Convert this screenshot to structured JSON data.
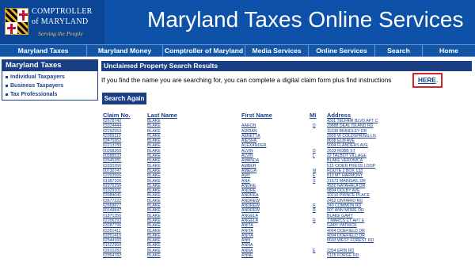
{
  "header": {
    "logo": {
      "line1": "COMPTROLLER",
      "line2": "of MARYLAND",
      "tagline": "Serving the People"
    },
    "title": "Maryland Taxes Online Services"
  },
  "nav": {
    "items": [
      {
        "label": "Maryland Taxes"
      },
      {
        "label": "Maryland Money"
      },
      {
        "label": "Comptroller of Maryland"
      },
      {
        "label": "Media Services"
      },
      {
        "label": "Online Services"
      },
      {
        "label": "Search"
      },
      {
        "label": "Home"
      }
    ]
  },
  "sidebar": {
    "heading": "Maryland Taxes",
    "items": [
      {
        "label": "Individual Taxpayers"
      },
      {
        "label": "Business Taxpayers"
      },
      {
        "label": "Tax Professionals"
      }
    ]
  },
  "main": {
    "section_title": "Unclaimed Property Search Results",
    "instructions": "If you find the name you are searching for, you can complete a digital claim form plus find instructions",
    "here_link": "HERE",
    "here_period": ".",
    "search_again": "Search Again"
  },
  "table": {
    "headers": {
      "claim": "Claim No.",
      "last": "Last Name",
      "first": "First Name",
      "mi": "MI",
      "address": "Address"
    },
    "rows": [
      {
        "claim": "02678742",
        "last": "BLAKE",
        "first": "",
        "mi": "",
        "address": "4311 TELFAIR BLVD APT C"
      },
      {
        "claim": "03324444",
        "last": "BLAKE",
        "first": "AARON",
        "mi": "D",
        "address": "29888 DEAL ISLAND RD"
      },
      {
        "claim": "02292553",
        "last": "BLAKE",
        "first": "ADRIAN",
        "mi": "",
        "address": "11038 BRINDLEY DR"
      },
      {
        "claim": "02099110",
        "last": "BLAKE",
        "first": "AENETTA",
        "mi": "",
        "address": "3909 W COLDSPRING LN"
      },
      {
        "claim": "03470362",
        "last": "BLAKE",
        "first": "AIESHA",
        "mi": "",
        "address": "8608 ELM AVE"
      },
      {
        "claim": "02213789",
        "last": "BLAKE",
        "first": "ALEXANDER",
        "mi": "",
        "address": "5004 FLANDERS AVE"
      },
      {
        "claim": "00268269",
        "last": "BLAKE",
        "first": "ALVIN",
        "mi": "D",
        "address": "2633 ROBB ST"
      },
      {
        "claim": "00388533",
        "last": "BLAKE",
        "first": "ALVIN",
        "mi": "L",
        "address": "22 TALBOT VILLAGE"
      },
      {
        "claim": "02645281",
        "last": "BLAKE",
        "first": "AMANDA",
        "mi": "",
        "address": "BLAKE VERONICA"
      },
      {
        "claim": "03320356",
        "last": "BLAKE",
        "first": "AMBER",
        "mi": "",
        "address": "515 CIDER PRESS LOOP"
      },
      {
        "claim": "00730747",
        "last": "BLAKE",
        "first": "AMELIA",
        "mi": "M",
        "address": "ROUTE 2 BOX 133"
      },
      {
        "claim": "02093566",
        "last": "BLAKE",
        "first": "AMY",
        "mi": "E",
        "address": "810 MT HARMONY"
      },
      {
        "claim": "01987166",
        "last": "BLAKE",
        "first": "ANA",
        "mi": "S",
        "address": "21673 MAINSAIL DR"
      },
      {
        "claim": "02976256",
        "last": "BLAKE",
        "first": "ANDRE",
        "mi": "",
        "address": "4550 NATAHALA DR"
      },
      {
        "claim": "01029101",
        "last": "BLAKE",
        "first": "ANDRE",
        "mi": "",
        "address": "9804 DOLBY AVE"
      },
      {
        "claim": "03084041",
        "last": "BLAKE",
        "first": "ANDREA",
        "mi": "",
        "address": "10210 PRINCE PLACE"
      },
      {
        "claim": "03677222",
        "last": "BLAKE",
        "first": "ANDREW",
        "mi": "",
        "address": "2452 ONTARIO RD"
      },
      {
        "claim": "02668877",
        "last": "BLAKE",
        "first": "ANDREW",
        "mi": "R",
        "address": "240 COMMON RD"
      },
      {
        "claim": "00149847",
        "last": "BLAKE",
        "first": "ANDREW",
        "mi": "R",
        "address": "907 ANN MORE DR"
      },
      {
        "claim": "01871356",
        "last": "BLAKE",
        "first": "ANGELA",
        "mi": "",
        "address": "BLAKE GARY"
      },
      {
        "claim": "02206293",
        "last": "BLAKE",
        "first": "ANGELA",
        "mi": "R",
        "address": "7 MARCS CT APT E"
      },
      {
        "claim": "03387796",
        "last": "BLAKE",
        "first": "ANITA",
        "mi": "",
        "address": "GARY PATRICK"
      },
      {
        "claim": "03351411",
        "last": "BLAKE",
        "first": "ANITA",
        "mi": "",
        "address": "4004 DOEFIELD DR"
      },
      {
        "claim": "03351410",
        "last": "BLAKE",
        "first": "ANITA",
        "mi": "",
        "address": "4004 DOEFIELD DR"
      },
      {
        "claim": "02544160",
        "last": "BLAKE",
        "first": "ANN",
        "mi": "",
        "address": "6603 WEST FOREST RD"
      },
      {
        "claim": "01522950",
        "last": "BLAKE",
        "first": "ANNA",
        "mi": "",
        "address": ""
      },
      {
        "claim": "02810282",
        "last": "BLAKE",
        "first": "ANNA",
        "mi": "E",
        "address": "2354 ERIN RD"
      },
      {
        "claim": "02954782",
        "last": "BLAKE",
        "first": "ANNE",
        "mi": "",
        "address": "5125 FORGE RD"
      }
    ]
  },
  "colors": {
    "header_bg": "#0d52a8",
    "nav_bg": "#1456a6",
    "accent_navy": "#1b3f85",
    "logo_gold": "#f0c64a",
    "highlight_red": "#d9232a"
  }
}
